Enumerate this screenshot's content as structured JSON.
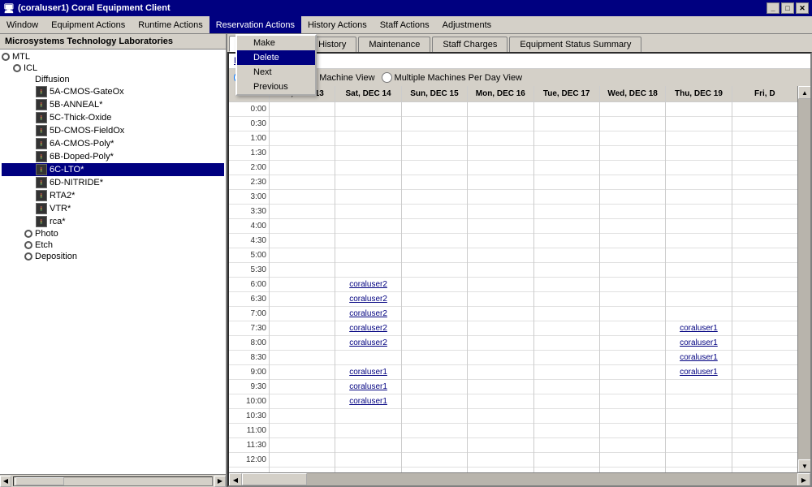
{
  "titleBar": {
    "icon": "🪸",
    "title": "(coraluser1) Coral Equipment Client",
    "minBtn": "_",
    "maxBtn": "□",
    "closeBtn": "✕"
  },
  "menuBar": {
    "items": [
      {
        "id": "window",
        "label": "Window"
      },
      {
        "id": "equipment-actions",
        "label": "Equipment Actions"
      },
      {
        "id": "runtime-actions",
        "label": "Runtime Actions"
      },
      {
        "id": "reservation-actions",
        "label": "Reservation Actions",
        "active": true
      },
      {
        "id": "history-actions",
        "label": "History Actions"
      },
      {
        "id": "staff-actions",
        "label": "Staff Actions"
      },
      {
        "id": "adjustments",
        "label": "Adjustments"
      }
    ]
  },
  "dropdown": {
    "items": [
      {
        "id": "make",
        "label": "Make"
      },
      {
        "id": "delete",
        "label": "Delete",
        "highlighted": true
      },
      {
        "id": "next",
        "label": "Next"
      },
      {
        "id": "previous",
        "label": "Previous"
      }
    ]
  },
  "leftPanel": {
    "header": "Microsystems Technology Laboratories",
    "tree": [
      {
        "id": "mtl",
        "label": "MTL",
        "indent": 0,
        "icon": "circle"
      },
      {
        "id": "icl",
        "label": "ICL",
        "indent": 1,
        "icon": "circle"
      },
      {
        "id": "diffusion",
        "label": "Diffusion",
        "indent": 2,
        "icon": "folder"
      },
      {
        "id": "5a-cmos",
        "label": "5A-CMOS-GateOx",
        "indent": 3,
        "icon": "traffic"
      },
      {
        "id": "5b-anneal",
        "label": "5B-ANNEAL*",
        "indent": 3,
        "icon": "traffic"
      },
      {
        "id": "5c-thick",
        "label": "5C-Thick-Oxide",
        "indent": 3,
        "icon": "traffic"
      },
      {
        "id": "5d-cmos",
        "label": "5D-CMOS-FieldOx",
        "indent": 3,
        "icon": "traffic"
      },
      {
        "id": "6a-cmos",
        "label": "6A-CMOS-Poly*",
        "indent": 3,
        "icon": "traffic"
      },
      {
        "id": "6b-doped",
        "label": "6B-Doped-Poly*",
        "indent": 3,
        "icon": "traffic"
      },
      {
        "id": "6c-lto",
        "label": "6C-LTO*",
        "indent": 3,
        "icon": "traffic",
        "selected": true
      },
      {
        "id": "6d-nitride",
        "label": "6D-NITRIDE*",
        "indent": 3,
        "icon": "traffic"
      },
      {
        "id": "rta2",
        "label": "RTA2*",
        "indent": 3,
        "icon": "traffic"
      },
      {
        "id": "vtr",
        "label": "VTR*",
        "indent": 3,
        "icon": "traffic"
      },
      {
        "id": "rca",
        "label": "rca*",
        "indent": 3,
        "icon": "traffic"
      },
      {
        "id": "photo",
        "label": "Photo",
        "indent": 2,
        "icon": "circle-folder"
      },
      {
        "id": "etch",
        "label": "Etch",
        "indent": 2,
        "icon": "circle-folder"
      },
      {
        "id": "deposition",
        "label": "Deposition",
        "indent": 2,
        "icon": "circle-folder"
      }
    ]
  },
  "rightPanel": {
    "tabs": [
      {
        "id": "reservations",
        "label": "Reservations",
        "active": true
      },
      {
        "id": "history",
        "label": "History"
      },
      {
        "id": "maintenance",
        "label": "Maintenance"
      },
      {
        "id": "staff-charges",
        "label": "Staff Charges"
      },
      {
        "id": "equipment-status",
        "label": "Equipment Status Summary"
      }
    ],
    "reservationsLink": "Reservations",
    "viewOptions": {
      "option1": {
        "label": "Multiple Days Per Machine View",
        "checked": true
      },
      "option2": {
        "label": "Multiple Machines Per Day View",
        "checked": false
      }
    },
    "calendar": {
      "days": [
        {
          "id": "fri13",
          "label": "Fri, DEC 13"
        },
        {
          "id": "sat14",
          "label": "Sat, DEC 14"
        },
        {
          "id": "sun15",
          "label": "Sun, DEC 15"
        },
        {
          "id": "mon16",
          "label": "Mon, DEC 16"
        },
        {
          "id": "tue17",
          "label": "Tue, DEC 17"
        },
        {
          "id": "wed18",
          "label": "Wed, DEC 18"
        },
        {
          "id": "thu19",
          "label": "Thu, DEC 19"
        },
        {
          "id": "fri20",
          "label": "Fri, D"
        }
      ],
      "times": [
        "0:00",
        "0:30",
        "1:00",
        "1:30",
        "2:00",
        "2:30",
        "3:00",
        "3:30",
        "4:00",
        "4:30",
        "5:00",
        "5:30",
        "6:00",
        "6:30",
        "7:00",
        "7:30",
        "8:00",
        "8:30",
        "9:00",
        "9:30",
        "10:00",
        "10:30",
        "11:00",
        "11:30",
        "12:00"
      ],
      "reservations": {
        "sat14": {
          "6:00": "coraluser2",
          "6:30": "coraluser2",
          "7:00": "coraluser2",
          "7:30": "coraluser2",
          "8:00": "coraluser2",
          "9:00": "coraluser1",
          "9:30": "coraluser1",
          "10:00": "coraluser1"
        },
        "thu19": {
          "7:30": "coraluser1",
          "8:00": "coraluser1",
          "8:30": "coraluser1",
          "9:00": "coraluser1"
        }
      }
    }
  }
}
